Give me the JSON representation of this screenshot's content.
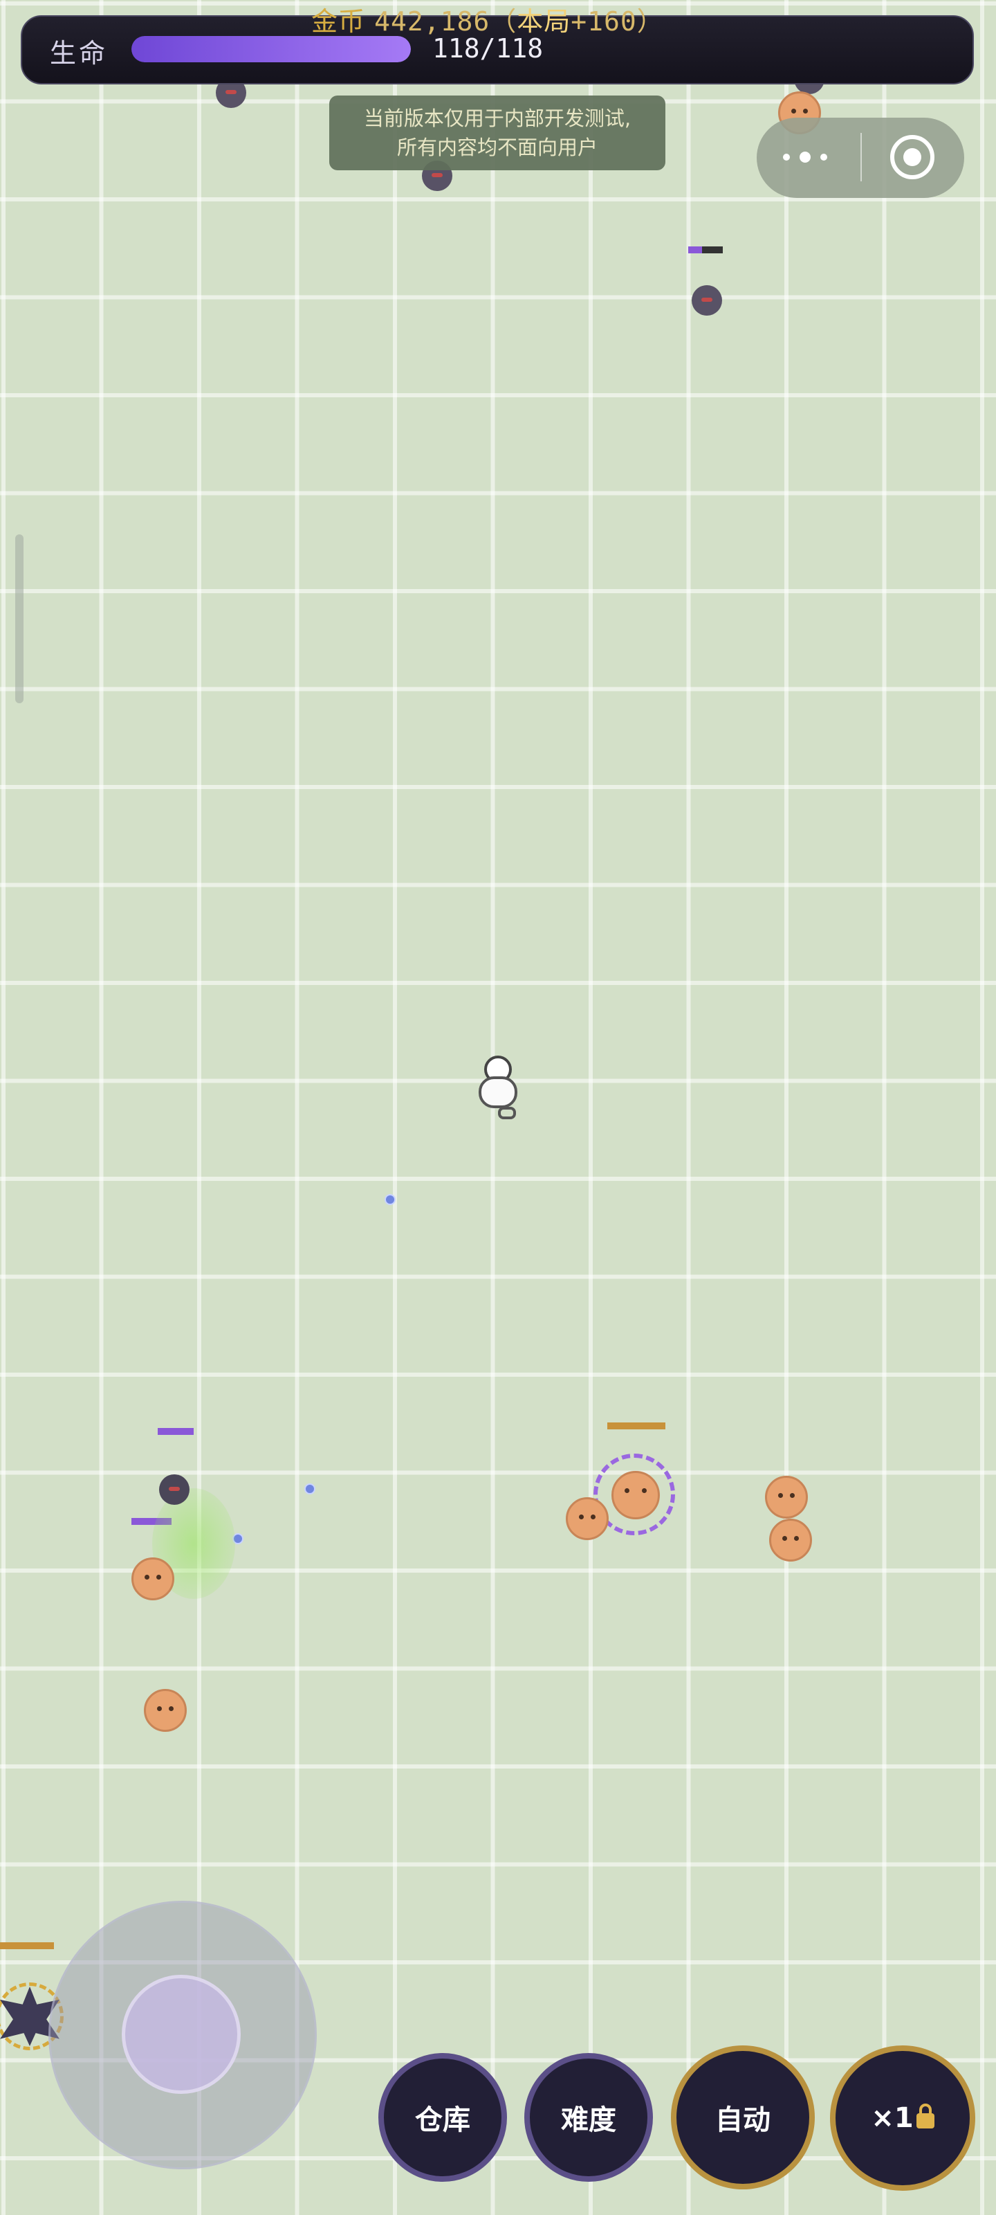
{
  "hud": {
    "gold_label": "金币",
    "gold_value": "442,186",
    "round_open": "（",
    "round_label": "本局",
    "round_value": "+160）",
    "hp_label": "生命",
    "hp_text": "118/118",
    "hp_fraction": 1.0
  },
  "notice": {
    "line1": "当前版本仅用于内部开发测试,",
    "line2": "所有内容均不面向用户"
  },
  "miniprogram": {
    "more_icon": "more-dots-icon",
    "close_icon": "target-circle-icon"
  },
  "controls": {
    "warehouse": "仓库",
    "difficulty": "难度",
    "auto": "自动",
    "speed": "×1"
  },
  "colors": {
    "ground": "#d3e0c8",
    "hp_fill": "#8a5ee8",
    "gold_text": "#d7ad41",
    "button_bg": "#221f36"
  }
}
